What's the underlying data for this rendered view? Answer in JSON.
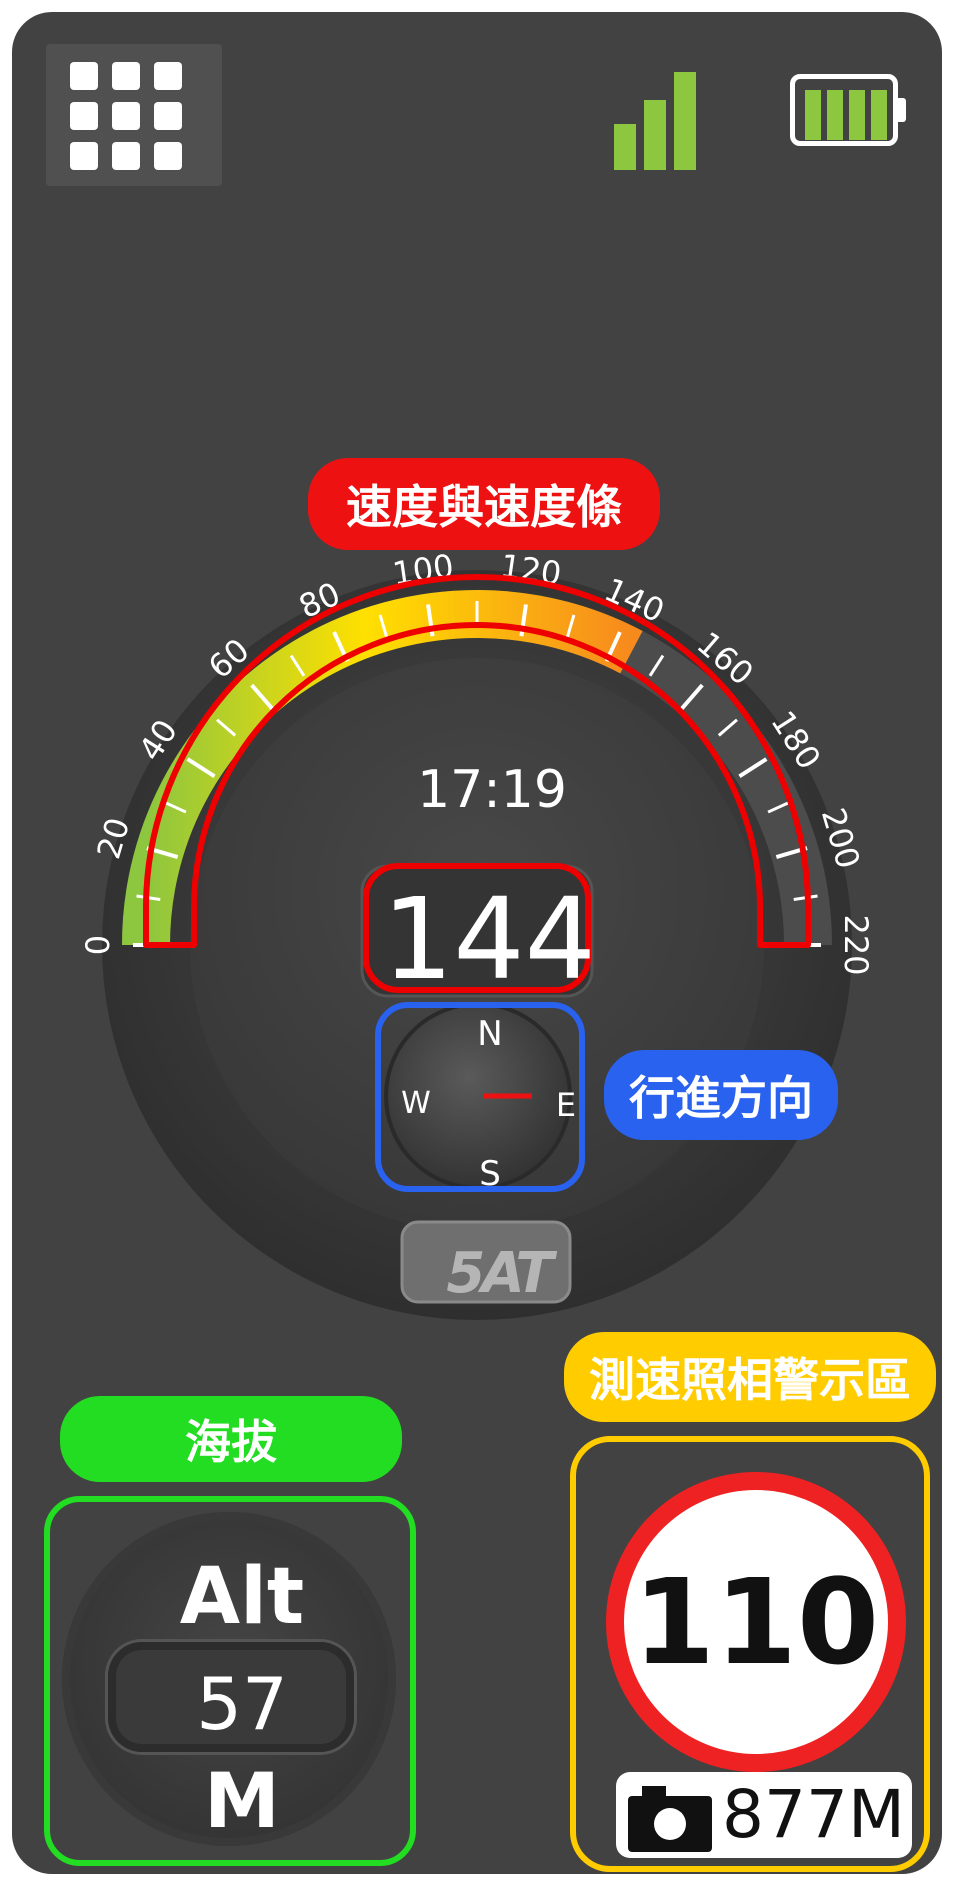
{
  "status_bar": {
    "menu_icon": "grid-icon",
    "signal_icon": "signal-icon",
    "battery_icon": "battery-icon",
    "accent_color": "#8dc63f"
  },
  "labels": {
    "speed": "速度與速度條",
    "heading": "行進方向",
    "altitude": "海拔",
    "camera": "測速照相警示區"
  },
  "gauge": {
    "time": "17:19",
    "speed": "144",
    "ticks": [
      "0",
      "20",
      "40",
      "60",
      "80",
      "100",
      "120",
      "140",
      "160",
      "180",
      "200",
      "220"
    ],
    "max": 220,
    "speed_fraction_of_max": 0.6545
  },
  "compass": {
    "north": "N",
    "south": "S",
    "east": "E",
    "west": "W",
    "heading_direction": "E"
  },
  "logo_text": "5AT",
  "altitude": {
    "title": "Alt",
    "value": "57",
    "unit": "M"
  },
  "speed_camera": {
    "limit": "110",
    "distance": "877M",
    "camera_icon": "camera-icon"
  },
  "colors": {
    "speed_label": "#ee1111",
    "heading_label": "#2a62f0",
    "altitude_label": "#22dd22",
    "camera_label": "#ffcc00"
  }
}
